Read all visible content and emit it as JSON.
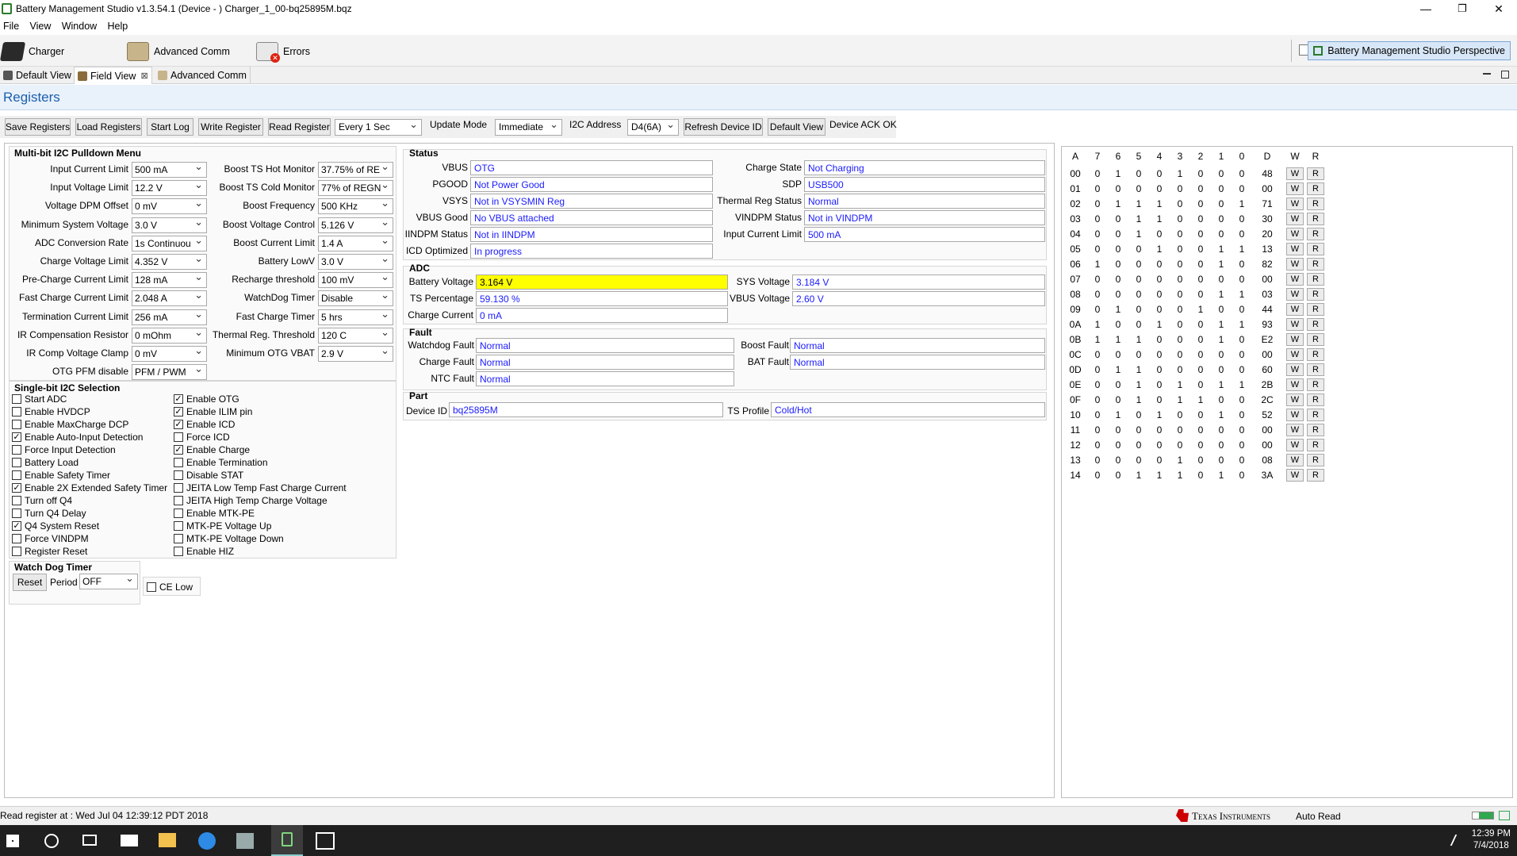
{
  "window": {
    "title": "Battery Management Studio v1.3.54.1  (Device - )  Charger_1_00-bq25895M.bqz",
    "minimize": "—",
    "restore": "❐",
    "close": "✕"
  },
  "menu": [
    "File",
    "View",
    "Window",
    "Help"
  ],
  "toolbar": {
    "items": [
      "Charger",
      "Advanced Comm",
      "Errors"
    ],
    "perspective": "Battery Management Studio Perspective"
  },
  "view_tabs": [
    "Default View",
    "Field View",
    "Advanced Comm"
  ],
  "view_tab_close": "⊠",
  "section_title": "Registers",
  "actions": {
    "save": "Save Registers",
    "load": "Load Registers",
    "start_log": "Start Log",
    "write": "Write Register",
    "read": "Read Register",
    "interval": "Every 1 Sec",
    "update_mode_label": "Update Mode",
    "update_mode": "Immediate",
    "i2c_label": "I2C Address",
    "i2c_value": "D4(6A)",
    "refresh": "Refresh Device ID",
    "default_view": "Default View",
    "ack": "Device ACK OK"
  },
  "multibit": {
    "title": "Multi-bit I2C Pulldown Menu",
    "left": [
      {
        "label": "Input Current Limit",
        "value": "500 mA"
      },
      {
        "label": "Input Voltage Limit",
        "value": "12.2 V"
      },
      {
        "label": "Voltage DPM Offset",
        "value": "0 mV"
      },
      {
        "label": "Minimum System Voltage",
        "value": "3.0 V"
      },
      {
        "label": "ADC Conversion Rate",
        "value": "1s Continuou"
      },
      {
        "label": "Charge Voltage Limit",
        "value": "4.352 V"
      },
      {
        "label": "Pre-Charge Current Limit",
        "value": "128 mA"
      },
      {
        "label": "Fast Charge Current Limit",
        "value": "2.048 A"
      },
      {
        "label": "Termination Current Limit",
        "value": "256 mA"
      },
      {
        "label": "IR Compensation Resistor",
        "value": "0 mOhm"
      },
      {
        "label": "IR Comp Voltage Clamp",
        "value": "0 mV"
      },
      {
        "label": "OTG PFM disable",
        "value": "PFM / PWM"
      }
    ],
    "right": [
      {
        "label": "Boost TS Hot Monitor",
        "value": "37.75% of RE"
      },
      {
        "label": "Boost TS Cold Monitor",
        "value": "77% of REGN"
      },
      {
        "label": "Boost Frequency",
        "value": "500 KHz"
      },
      {
        "label": "Boost Voltage Control",
        "value": "5.126 V"
      },
      {
        "label": "Boost Current Limit",
        "value": "1.4 A"
      },
      {
        "label": "Battery LowV",
        "value": "3.0 V"
      },
      {
        "label": "Recharge threshold",
        "value": "100 mV"
      },
      {
        "label": "WatchDog Timer",
        "value": "Disable"
      },
      {
        "label": "Fast Charge Timer",
        "value": "5 hrs"
      },
      {
        "label": "Thermal Reg. Threshold",
        "value": "120 C"
      },
      {
        "label": "Minimum OTG VBAT",
        "value": "2.9 V"
      }
    ]
  },
  "singlebit": {
    "title": "Single-bit I2C Selection",
    "check": "✓",
    "left": [
      {
        "label": "Start ADC",
        "checked": false
      },
      {
        "label": "Enable HVDCP",
        "checked": false
      },
      {
        "label": "Enable MaxCharge DCP",
        "checked": false
      },
      {
        "label": "Enable Auto-Input Detection",
        "checked": true
      },
      {
        "label": "Force Input Detection",
        "checked": false
      },
      {
        "label": "Battery Load",
        "checked": false
      },
      {
        "label": "Enable Safety Timer",
        "checked": false
      },
      {
        "label": "Enable 2X Extended Safety Timer",
        "checked": true
      },
      {
        "label": "Turn off Q4",
        "checked": false
      },
      {
        "label": "Turn Q4 Delay",
        "checked": false
      },
      {
        "label": "Q4 System Reset",
        "checked": true
      },
      {
        "label": "Force VINDPM",
        "checked": false
      },
      {
        "label": "Register Reset",
        "checked": false
      }
    ],
    "right": [
      {
        "label": "Enable OTG",
        "checked": true
      },
      {
        "label": "Enable ILIM pin",
        "checked": true
      },
      {
        "label": "Enable ICD",
        "checked": true
      },
      {
        "label": "Force ICD",
        "checked": false
      },
      {
        "label": "Enable Charge",
        "checked": true
      },
      {
        "label": "Enable Termination",
        "checked": false
      },
      {
        "label": "Disable STAT",
        "checked": false
      },
      {
        "label": "JEITA Low Temp Fast Charge Current",
        "checked": false
      },
      {
        "label": "JEITA High Temp Charge Voltage",
        "checked": false
      },
      {
        "label": "Enable MTK-PE",
        "checked": false
      },
      {
        "label": "MTK-PE Voltage Up",
        "checked": false
      },
      {
        "label": "MTK-PE Voltage Down",
        "checked": false
      },
      {
        "label": "Enable HIZ",
        "checked": false
      }
    ]
  },
  "watchdog": {
    "title": "Watch Dog Timer",
    "reset": "Reset",
    "period_label": "Period",
    "period": "OFF",
    "ce_low": "CE Low"
  },
  "status": {
    "title": "Status",
    "left": [
      {
        "label": "VBUS",
        "value": "OTG"
      },
      {
        "label": "PGOOD",
        "value": "Not Power Good"
      },
      {
        "label": "VSYS",
        "value": "Not in VSYSMIN Reg"
      },
      {
        "label": "VBUS Good",
        "value": "No VBUS attached"
      },
      {
        "label": "IINDPM Status",
        "value": "Not in IINDPM"
      },
      {
        "label": "ICD Optimized",
        "value": "In progress"
      }
    ],
    "right": [
      {
        "label": "Charge State",
        "value": "Not Charging"
      },
      {
        "label": "SDP",
        "value": "USB500"
      },
      {
        "label": "Thermal Reg Status",
        "value": "Normal"
      },
      {
        "label": "VINDPM Status",
        "value": "Not in VINDPM"
      },
      {
        "label": "Input Current Limit",
        "value": "500 mA"
      }
    ]
  },
  "adc": {
    "title": "ADC",
    "left": [
      {
        "label": "Battery Voltage",
        "value": "3.164 V"
      },
      {
        "label": "TS Percentage",
        "value": "59.130 %"
      },
      {
        "label": "Charge Current",
        "value": "0 mA"
      }
    ],
    "right": [
      {
        "label": "SYS Voltage",
        "value": "3.184 V"
      },
      {
        "label": "VBUS Voltage",
        "value": "2.60 V"
      }
    ],
    "highlight": "#ffff00"
  },
  "fault": {
    "title": "Fault",
    "left": [
      {
        "label": "Watchdog Fault",
        "value": "Normal"
      },
      {
        "label": "Charge Fault",
        "value": "Normal"
      },
      {
        "label": "NTC Fault",
        "value": "Normal"
      }
    ],
    "right": [
      {
        "label": "Boost Fault",
        "value": "Normal"
      },
      {
        "label": "BAT Fault",
        "value": "Normal"
      }
    ]
  },
  "part": {
    "title": "Part",
    "device_label": "Device ID",
    "device": "bq25895M",
    "ts_label": "TS Profile",
    "ts": "Cold/Hot"
  },
  "registers": {
    "headers": [
      "A",
      "7",
      "6",
      "5",
      "4",
      "3",
      "2",
      "1",
      "0",
      "D",
      "W",
      "R"
    ],
    "rows": [
      [
        "00",
        "0",
        "1",
        "0",
        "0",
        "1",
        "0",
        "0",
        "0",
        "48"
      ],
      [
        "01",
        "0",
        "0",
        "0",
        "0",
        "0",
        "0",
        "0",
        "0",
        "00"
      ],
      [
        "02",
        "0",
        "1",
        "1",
        "1",
        "0",
        "0",
        "0",
        "1",
        "71"
      ],
      [
        "03",
        "0",
        "0",
        "1",
        "1",
        "0",
        "0",
        "0",
        "0",
        "30"
      ],
      [
        "04",
        "0",
        "0",
        "1",
        "0",
        "0",
        "0",
        "0",
        "0",
        "20"
      ],
      [
        "05",
        "0",
        "0",
        "0",
        "1",
        "0",
        "0",
        "1",
        "1",
        "13"
      ],
      [
        "06",
        "1",
        "0",
        "0",
        "0",
        "0",
        "0",
        "1",
        "0",
        "82"
      ],
      [
        "07",
        "0",
        "0",
        "0",
        "0",
        "0",
        "0",
        "0",
        "0",
        "00"
      ],
      [
        "08",
        "0",
        "0",
        "0",
        "0",
        "0",
        "0",
        "1",
        "1",
        "03"
      ],
      [
        "09",
        "0",
        "1",
        "0",
        "0",
        "0",
        "1",
        "0",
        "0",
        "44"
      ],
      [
        "0A",
        "1",
        "0",
        "0",
        "1",
        "0",
        "0",
        "1",
        "1",
        "93"
      ],
      [
        "0B",
        "1",
        "1",
        "1",
        "0",
        "0",
        "0",
        "1",
        "0",
        "E2"
      ],
      [
        "0C",
        "0",
        "0",
        "0",
        "0",
        "0",
        "0",
        "0",
        "0",
        "00"
      ],
      [
        "0D",
        "0",
        "1",
        "1",
        "0",
        "0",
        "0",
        "0",
        "0",
        "60"
      ],
      [
        "0E",
        "0",
        "0",
        "1",
        "0",
        "1",
        "0",
        "1",
        "1",
        "2B"
      ],
      [
        "0F",
        "0",
        "0",
        "1",
        "0",
        "1",
        "1",
        "0",
        "0",
        "2C"
      ],
      [
        "10",
        "0",
        "1",
        "0",
        "1",
        "0",
        "0",
        "1",
        "0",
        "52"
      ],
      [
        "11",
        "0",
        "0",
        "0",
        "0",
        "0",
        "0",
        "0",
        "0",
        "00"
      ],
      [
        "12",
        "0",
        "0",
        "0",
        "0",
        "0",
        "0",
        "0",
        "0",
        "00"
      ],
      [
        "13",
        "0",
        "0",
        "0",
        "0",
        "1",
        "0",
        "0",
        "0",
        "08"
      ],
      [
        "14",
        "0",
        "0",
        "1",
        "1",
        "1",
        "0",
        "1",
        "0",
        "3A"
      ]
    ],
    "w_label": "W",
    "r_label": "R"
  },
  "statusbar": {
    "read_text": "Read register at : Wed Jul 04 12:39:12 PDT 2018",
    "brand": "Texas Instruments",
    "auto_read": "Auto Read"
  },
  "taskbar": {
    "time": "12:39 PM",
    "date": "7/4/2018"
  },
  "colors": {
    "accent": "#1b5fad",
    "value_text": "#1a1aff",
    "taskbar": "#1f1f1f",
    "ti_red": "#cc0000"
  }
}
